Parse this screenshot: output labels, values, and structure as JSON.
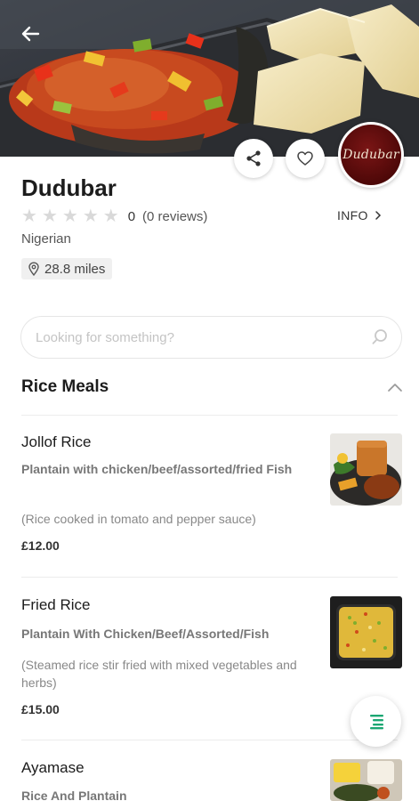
{
  "restaurant": {
    "name": "Dudubar",
    "logo_text": "Dudubar",
    "rating_value": "0",
    "reviews": "(0 reviews)",
    "info_label": "INFO",
    "cuisine": "Nigerian",
    "distance": "28.8 miles",
    "rating_stars": 0,
    "star_count": 5
  },
  "search": {
    "placeholder": "Looking for something?"
  },
  "section": {
    "title": "Rice Meals",
    "expanded": true
  },
  "menu_items": [
    {
      "name": "Jollof Rice",
      "subtitle": "Plantain with chicken/beef/assorted/fried Fish",
      "description": "(Rice cooked in tomato and pepper sauce)",
      "price": "£12.00"
    },
    {
      "name": "Fried Rice",
      "subtitle": "Plantain With Chicken/Beef/Assorted/Fish",
      "description": "(Steamed rice stir fried with mixed vegetables and herbs)",
      "price": "£15.00"
    },
    {
      "name": "Ayamase",
      "subtitle": "Rice And Plantain",
      "description": "",
      "price": ""
    }
  ],
  "icons": {
    "back": "arrow-left-icon",
    "share": "share-icon",
    "favorite": "heart-icon",
    "location": "map-pin-icon",
    "search": "search-icon",
    "collapse": "chevron-up-icon",
    "menu_list": "list-icon"
  },
  "colors": {
    "accent_green": "#1ba672",
    "logo_maroon": "#5a0a0a",
    "star_empty": "#d9d9d9"
  }
}
